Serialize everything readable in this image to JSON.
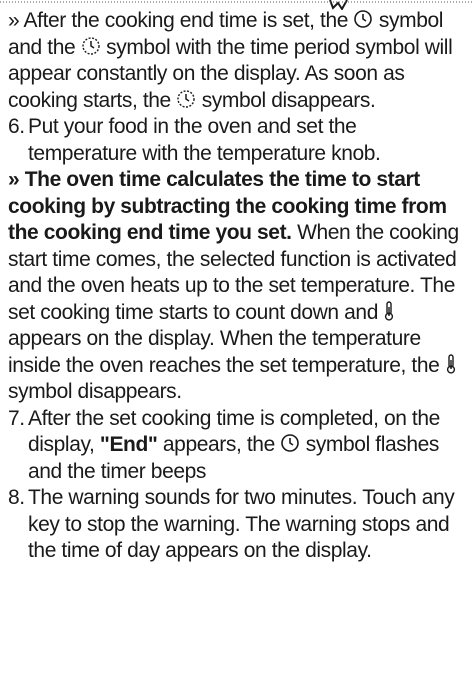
{
  "paragraphs": {
    "p1": {
      "a": "» After the cooking end time is set, the",
      "b": "symbol and the",
      "c": "symbol with the time period symbol will appear constantly on the display. As soon as cooking starts, the",
      "d": "symbol disappears."
    },
    "step6": {
      "num": "6.",
      "text": "Put your food in the oven and set the temperature with the temperature knob."
    },
    "p2": {
      "bold": "» The oven time calculates the time to start cooking by subtracting the cooking time from the cooking end time you set.",
      "a": "When the cooking start time comes, the selected function is activated and the oven heats up to the set temperature. The set cooking time starts to count down and",
      "b": "appears on the display. When the temperature inside the oven reaches the set temperature, the",
      "c": "symbol disappears."
    },
    "step7": {
      "num": "7.",
      "a": "After the set cooking time is completed, on the display,",
      "end": "\"End\"",
      "b": "appears, the",
      "c": "symbol flashes and the timer beeps"
    },
    "step8": {
      "num": "8.",
      "text": "The warning sounds for two minutes. Touch any key to stop the warning. The warning stops and the time of day appears on the display."
    }
  },
  "icons": {
    "clock": "clock-icon",
    "timer": "timer-icon",
    "thermometer": "thermometer-icon"
  }
}
